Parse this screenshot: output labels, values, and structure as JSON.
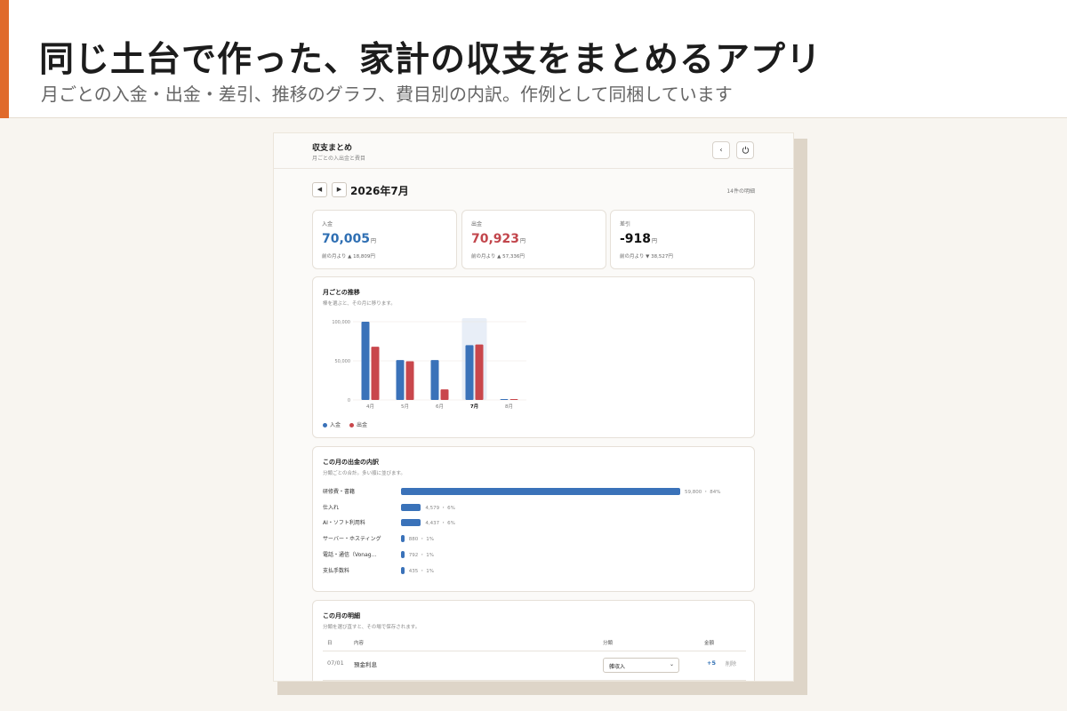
{
  "banner": {
    "headline": "同じ土台で作った、家計の収支をまとめるアプリ",
    "subline": "月ごとの入金・出金・差引、推移のグラフ、費目別の内訳。作例として同梱しています",
    "accent_color": "#e06a2b"
  },
  "app": {
    "title": "収支まとめ",
    "subtitle": "月ごとの入出金と費目",
    "back_icon": "chevron-left-icon",
    "power_icon": "power-icon"
  },
  "month_nav": {
    "prev_label": "◀",
    "next_label": "▶",
    "month": "2026年7月",
    "count": "14件の明細"
  },
  "summary": {
    "income": {
      "label": "入金",
      "value": "70,005",
      "unit": "円",
      "compare": "前の月より ▲ 18,809円",
      "color": "#2f6fb3"
    },
    "expense": {
      "label": "出金",
      "value": "70,923",
      "unit": "円",
      "compare": "前の月より ▲ 57,336円",
      "color": "#c2464c"
    },
    "diff": {
      "label": "差引",
      "value": "-918",
      "unit": "円",
      "compare": "前の月より ▼ 38,527円",
      "color": "#111111"
    }
  },
  "trend": {
    "title": "月ごとの推移",
    "subtitle": "棒を選ぶと、その月に移ります。",
    "legend_income": "入金",
    "legend_expense": "出金"
  },
  "chart_data": {
    "type": "bar",
    "categories": [
      "4月",
      "5月",
      "6月",
      "7月",
      "8月"
    ],
    "selected_category": "7月",
    "series": [
      {
        "name": "入金",
        "values": [
          100000,
          51000,
          51000,
          70005,
          1000
        ],
        "color": "#3a72b9"
      },
      {
        "name": "出金",
        "values": [
          68000,
          49500,
          13500,
          70923,
          1000
        ],
        "color": "#c9474c"
      }
    ],
    "y_ticks": [
      "0",
      "50,000",
      "100,000"
    ],
    "ylim": [
      0,
      100000
    ],
    "grid": true,
    "legend": "bottom-left"
  },
  "breakdown": {
    "title": "この月の出金の内訳",
    "subtitle": "分類ごとの合計。多い順に並びます。",
    "items": [
      {
        "label": "研修費・書籍",
        "amount": "59,800 ・ 84%",
        "share": 84
      },
      {
        "label": "仕入れ",
        "amount": "4,579 ・ 6%",
        "share": 6
      },
      {
        "label": "AI・ソフト利用料",
        "amount": "4,437 ・ 6%",
        "share": 6
      },
      {
        "label": "サーバー・ホスティング",
        "amount": "880 ・ 1%",
        "share": 1
      },
      {
        "label": "電話・通信（Vonag…",
        "amount": "792 ・ 1%",
        "share": 1
      },
      {
        "label": "支払手数料",
        "amount": "435 ・ 1%",
        "share": 1
      }
    ],
    "bar_color": "#3a72b9"
  },
  "detail": {
    "title": "この月の明細",
    "subtitle": "分類を選び直すと、その場で保存されます。",
    "headers": {
      "day": "日",
      "content": "内容",
      "category": "分類",
      "amount": "金額"
    },
    "rows": [
      {
        "date": "07/01",
        "content": "預金利息",
        "category": "雑収入",
        "amount": "+5",
        "delete": "削除"
      }
    ]
  }
}
